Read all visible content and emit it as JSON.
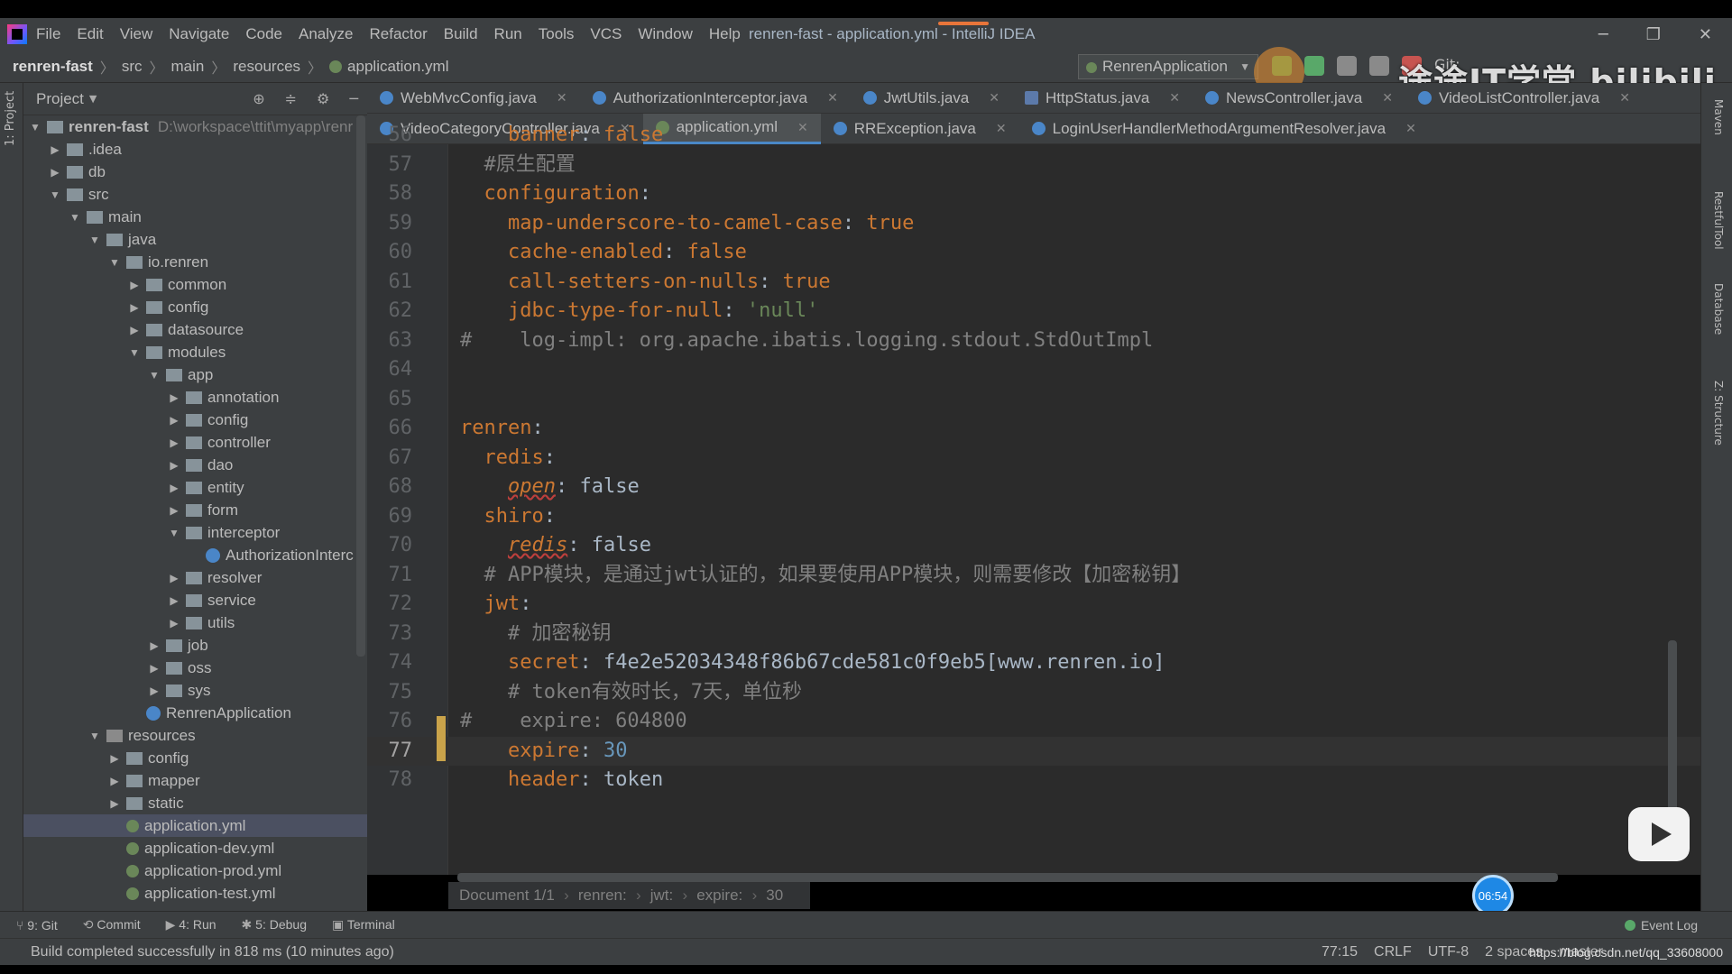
{
  "menu": [
    "File",
    "Edit",
    "View",
    "Navigate",
    "Code",
    "Analyze",
    "Refactor",
    "Build",
    "Run",
    "Tools",
    "VCS",
    "Window",
    "Help"
  ],
  "window_title": "renren-fast - application.yml - IntelliJ IDEA",
  "breadcrumb": [
    "renren-fast",
    "src",
    "main",
    "resources",
    "application.yml"
  ],
  "run_config": "RenrenApplication",
  "git_label": "Git:",
  "watermark": "途途IT学堂 bilibili",
  "left_stripe_label": "1: Project",
  "project_panel": {
    "title": "Project",
    "root_path": "D:\\workspace\\ttit\\myapp\\renr",
    "tree": [
      {
        "label": "renren-fast",
        "depth": 0,
        "arrow": "▼",
        "icon": "module"
      },
      {
        "label": ".idea",
        "depth": 1,
        "arrow": "▶",
        "icon": "folder"
      },
      {
        "label": "db",
        "depth": 1,
        "arrow": "▶",
        "icon": "folder"
      },
      {
        "label": "src",
        "depth": 1,
        "arrow": "▼",
        "icon": "folder"
      },
      {
        "label": "main",
        "depth": 2,
        "arrow": "▼",
        "icon": "folder"
      },
      {
        "label": "java",
        "depth": 3,
        "arrow": "▼",
        "icon": "folder"
      },
      {
        "label": "io.renren",
        "depth": 4,
        "arrow": "▼",
        "icon": "folder"
      },
      {
        "label": "common",
        "depth": 5,
        "arrow": "▶",
        "icon": "folder"
      },
      {
        "label": "config",
        "depth": 5,
        "arrow": "▶",
        "icon": "folder"
      },
      {
        "label": "datasource",
        "depth": 5,
        "arrow": "▶",
        "icon": "folder"
      },
      {
        "label": "modules",
        "depth": 5,
        "arrow": "▼",
        "icon": "folder"
      },
      {
        "label": "app",
        "depth": 6,
        "arrow": "▼",
        "icon": "folder"
      },
      {
        "label": "annotation",
        "depth": 7,
        "arrow": "▶",
        "icon": "folder"
      },
      {
        "label": "config",
        "depth": 7,
        "arrow": "▶",
        "icon": "folder"
      },
      {
        "label": "controller",
        "depth": 7,
        "arrow": "▶",
        "icon": "folder"
      },
      {
        "label": "dao",
        "depth": 7,
        "arrow": "▶",
        "icon": "folder"
      },
      {
        "label": "entity",
        "depth": 7,
        "arrow": "▶",
        "icon": "folder"
      },
      {
        "label": "form",
        "depth": 7,
        "arrow": "▶",
        "icon": "folder"
      },
      {
        "label": "interceptor",
        "depth": 7,
        "arrow": "▼",
        "icon": "folder"
      },
      {
        "label": "AuthorizationInterc",
        "depth": 8,
        "arrow": "",
        "icon": "class"
      },
      {
        "label": "resolver",
        "depth": 7,
        "arrow": "▶",
        "icon": "folder"
      },
      {
        "label": "service",
        "depth": 7,
        "arrow": "▶",
        "icon": "folder"
      },
      {
        "label": "utils",
        "depth": 7,
        "arrow": "▶",
        "icon": "folder"
      },
      {
        "label": "job",
        "depth": 6,
        "arrow": "▶",
        "icon": "folder"
      },
      {
        "label": "oss",
        "depth": 6,
        "arrow": "▶",
        "icon": "folder"
      },
      {
        "label": "sys",
        "depth": 6,
        "arrow": "▶",
        "icon": "folder"
      },
      {
        "label": "RenrenApplication",
        "depth": 5,
        "arrow": "",
        "icon": "class"
      },
      {
        "label": "resources",
        "depth": 3,
        "arrow": "▼",
        "icon": "folder-res"
      },
      {
        "label": "config",
        "depth": 4,
        "arrow": "▶",
        "icon": "folder"
      },
      {
        "label": "mapper",
        "depth": 4,
        "arrow": "▶",
        "icon": "folder"
      },
      {
        "label": "static",
        "depth": 4,
        "arrow": "▶",
        "icon": "folder"
      },
      {
        "label": "application.yml",
        "depth": 4,
        "arrow": "",
        "icon": "yml",
        "selected": true
      },
      {
        "label": "application-dev.yml",
        "depth": 4,
        "arrow": "",
        "icon": "yml"
      },
      {
        "label": "application-prod.yml",
        "depth": 4,
        "arrow": "",
        "icon": "yml"
      },
      {
        "label": "application-test.yml",
        "depth": 4,
        "arrow": "",
        "icon": "yml"
      }
    ]
  },
  "tabs_row1": [
    {
      "label": "WebMvcConfig.java",
      "icon": "c"
    },
    {
      "label": "AuthorizationInterceptor.java",
      "icon": "c"
    },
    {
      "label": "JwtUtils.java",
      "icon": "c"
    },
    {
      "label": "HttpStatus.java",
      "icon": "e"
    },
    {
      "label": "NewsController.java",
      "icon": "c"
    },
    {
      "label": "VideoListController.java",
      "icon": "c"
    }
  ],
  "tabs_row2": [
    {
      "label": "VideoCategoryController.java",
      "icon": "c"
    },
    {
      "label": "application.yml",
      "icon": "y",
      "active": true
    },
    {
      "label": "RRException.java",
      "icon": "c"
    },
    {
      "label": "LoginUserHandlerMethodArgumentResolver.java",
      "icon": "c"
    }
  ],
  "code_lines": [
    {
      "n": "56",
      "segs": [
        {
          "t": "    ",
          "c": ""
        },
        {
          "t": "banner",
          "c": "k"
        },
        {
          "t": ": ",
          "c": ""
        },
        {
          "t": "false",
          "c": "k"
        }
      ]
    },
    {
      "n": "57",
      "segs": [
        {
          "t": "  ",
          "c": ""
        },
        {
          "t": "#原生配置",
          "c": "cm"
        }
      ]
    },
    {
      "n": "58",
      "segs": [
        {
          "t": "  ",
          "c": ""
        },
        {
          "t": "configuration",
          "c": "k"
        },
        {
          "t": ":",
          "c": ""
        }
      ]
    },
    {
      "n": "59",
      "segs": [
        {
          "t": "    ",
          "c": ""
        },
        {
          "t": "map-underscore-to-camel-case",
          "c": "k"
        },
        {
          "t": ": ",
          "c": ""
        },
        {
          "t": "true",
          "c": "k"
        }
      ]
    },
    {
      "n": "60",
      "segs": [
        {
          "t": "    ",
          "c": ""
        },
        {
          "t": "cache-enabled",
          "c": "k"
        },
        {
          "t": ": ",
          "c": ""
        },
        {
          "t": "false",
          "c": "k"
        }
      ]
    },
    {
      "n": "61",
      "segs": [
        {
          "t": "    ",
          "c": ""
        },
        {
          "t": "call-setters-on-nulls",
          "c": "k"
        },
        {
          "t": ": ",
          "c": ""
        },
        {
          "t": "true",
          "c": "k"
        }
      ]
    },
    {
      "n": "62",
      "segs": [
        {
          "t": "    ",
          "c": ""
        },
        {
          "t": "jdbc-type-for-null",
          "c": "k"
        },
        {
          "t": ": ",
          "c": ""
        },
        {
          "t": "'null'",
          "c": "v-str"
        }
      ]
    },
    {
      "n": "63",
      "segs": [
        {
          "t": "#    log-impl: org.apache.ibatis.logging.stdout.StdOutImpl",
          "c": "cm"
        }
      ]
    },
    {
      "n": "64",
      "segs": []
    },
    {
      "n": "65",
      "segs": []
    },
    {
      "n": "66",
      "segs": [
        {
          "t": "renren",
          "c": "k"
        },
        {
          "t": ":",
          "c": ""
        }
      ]
    },
    {
      "n": "67",
      "segs": [
        {
          "t": "  ",
          "c": ""
        },
        {
          "t": "redis",
          "c": "k"
        },
        {
          "t": ":",
          "c": ""
        }
      ]
    },
    {
      "n": "68",
      "segs": [
        {
          "t": "    ",
          "c": ""
        },
        {
          "t": "open",
          "c": "k u"
        },
        {
          "t": ": false",
          "c": ""
        }
      ]
    },
    {
      "n": "69",
      "segs": [
        {
          "t": "  ",
          "c": ""
        },
        {
          "t": "shiro",
          "c": "k"
        },
        {
          "t": ":",
          "c": ""
        }
      ]
    },
    {
      "n": "70",
      "segs": [
        {
          "t": "    ",
          "c": ""
        },
        {
          "t": "redis",
          "c": "k u"
        },
        {
          "t": ": false",
          "c": ""
        }
      ]
    },
    {
      "n": "71",
      "segs": [
        {
          "t": "  ",
          "c": ""
        },
        {
          "t": "# APP模块，是通过jwt认证的，如果要使用APP模块，则需要修改【加密秘钥】",
          "c": "cm"
        }
      ]
    },
    {
      "n": "72",
      "segs": [
        {
          "t": "  ",
          "c": ""
        },
        {
          "t": "jwt",
          "c": "k"
        },
        {
          "t": ":",
          "c": ""
        }
      ]
    },
    {
      "n": "73",
      "segs": [
        {
          "t": "    ",
          "c": ""
        },
        {
          "t": "# 加密秘钥",
          "c": "cm"
        }
      ]
    },
    {
      "n": "74",
      "segs": [
        {
          "t": "    ",
          "c": ""
        },
        {
          "t": "secret",
          "c": "k"
        },
        {
          "t": ": f4e2e52034348f86b67cde581c0f9eb5[www.renren.io]",
          "c": ""
        }
      ]
    },
    {
      "n": "75",
      "segs": [
        {
          "t": "    ",
          "c": ""
        },
        {
          "t": "# token有效时长，7天，单位秒",
          "c": "cm"
        }
      ]
    },
    {
      "n": "76",
      "segs": [
        {
          "t": "#    expire: 604800",
          "c": "cm"
        }
      ]
    },
    {
      "n": "77",
      "segs": [
        {
          "t": "    ",
          "c": ""
        },
        {
          "t": "expire",
          "c": "k"
        },
        {
          "t": ": ",
          "c": ""
        },
        {
          "t": "30",
          "c": "v-num"
        }
      ],
      "current": true
    },
    {
      "n": "78",
      "segs": [
        {
          "t": "    ",
          "c": ""
        },
        {
          "t": "header",
          "c": "k"
        },
        {
          "t": ": token",
          "c": ""
        }
      ]
    }
  ],
  "editor_breadcrumb": [
    "Document 1/1",
    "renren:",
    "jwt:",
    "expire:",
    "30"
  ],
  "timer": "06:54",
  "right_stripe": [
    "Maven",
    "RestfulTool",
    "Database",
    "Z: Structure"
  ],
  "tool_windows": [
    "9: Git",
    "Commit",
    "4: Run",
    "5: Debug",
    "Terminal"
  ],
  "event_log": "Event Log",
  "status_message": "Build completed successfully in 818 ms (10 minutes ago)",
  "status_right": [
    "77:15",
    "CRLF",
    "UTF-8",
    "2 spaces",
    "master"
  ],
  "csdn": "https://blog.csdn.net/qq_33608000"
}
